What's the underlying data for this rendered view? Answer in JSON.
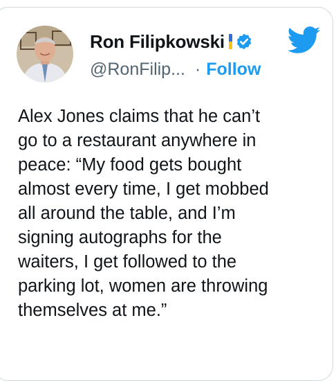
{
  "author": {
    "display_name": "Ron Filipkowski",
    "handle": "@RonFilip...",
    "separator": "·",
    "follow_label": "Follow",
    "verified": true,
    "flag": "ukraine-flag-icon"
  },
  "brand": {
    "logo": "twitter-bird-icon",
    "color": "#1d9bf0"
  },
  "tweet": {
    "text": "Alex Jones claims that he can’t\ngo to a restaurant anywhere in\npeace: “My food gets bought\nalmost every time, I get mobbed\nall around the table, and I’m\nsigning autographs for the\nwaiters, I get followed to the\nparking lot, women are throwing\nthemselves at me.”"
  },
  "colors": {
    "text_primary": "#0f1419",
    "text_secondary": "#536471",
    "border": "#cfd9de"
  }
}
